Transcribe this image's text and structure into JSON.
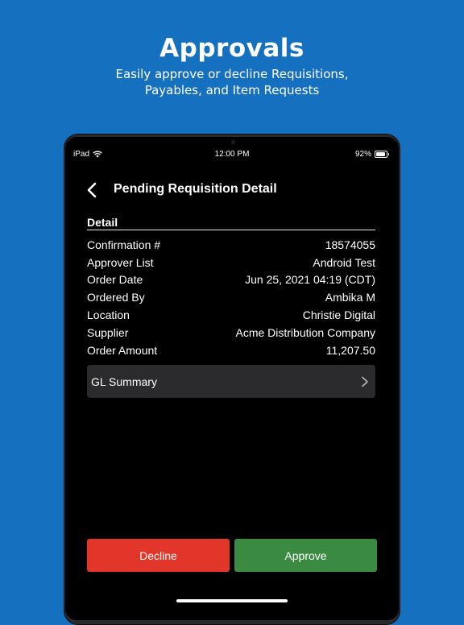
{
  "hero": {
    "title": "Approvals",
    "subtitle_line1": "Easily approve or decline Requisitions,",
    "subtitle_line2": "Payables, and Item Requests"
  },
  "status_bar": {
    "device": "iPad",
    "time": "12:00 PM",
    "battery": "92%",
    "battery_level": 0.92
  },
  "nav": {
    "title": "Pending Requisition Detail"
  },
  "detail": {
    "section_title": "Detail",
    "rows": [
      {
        "label": "Confirmation #",
        "value": "18574055"
      },
      {
        "label": "Approver List",
        "value": "Android Test"
      },
      {
        "label": "Order Date",
        "value": "Jun 25, 2021 04:19 (CDT)"
      },
      {
        "label": "Ordered By",
        "value": "Ambika M"
      },
      {
        "label": "Location",
        "value": "Christie Digital"
      },
      {
        "label": "Supplier",
        "value": "Acme Distribution Company"
      },
      {
        "label": "Order Amount",
        "value": "11,207.50"
      }
    ]
  },
  "gl_summary": {
    "label": "GL Summary"
  },
  "actions": {
    "decline_label": "Decline",
    "approve_label": "Approve"
  },
  "colors": {
    "background": "#1570bf",
    "decline": "#e13629",
    "approve": "#3a8a41"
  }
}
